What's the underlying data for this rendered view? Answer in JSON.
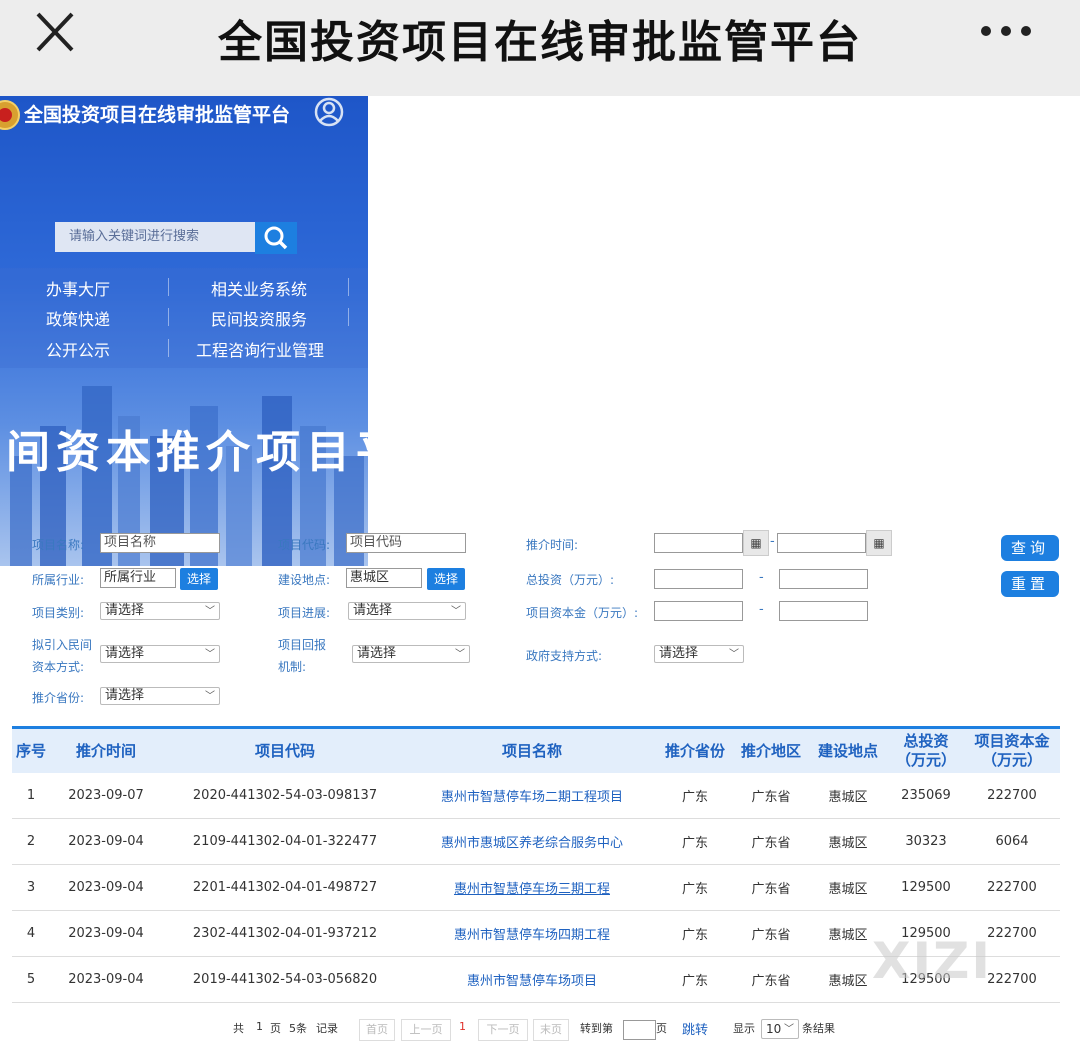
{
  "topbar": {
    "title": "全国投资项目在线审批监管平台"
  },
  "site": {
    "title": "全国投资项目在线审批监管平台"
  },
  "search": {
    "placeholder": "请输入关键词进行搜索"
  },
  "nav": {
    "items": [
      "办事大厅",
      "相关业务系统",
      "政策快递",
      "民间投资服务",
      "公开公示",
      "工程咨询行业管理"
    ]
  },
  "banner": {
    "text": "间资本推介项目平"
  },
  "form": {
    "project_name_label": "项目名称:",
    "project_name_placeholder": "项目名称",
    "project_code_label": "项目代码:",
    "project_code_placeholder": "项目代码",
    "promo_time_label": "推介时间:",
    "date_dash": "-",
    "industry_label": "所属行业:",
    "industry_placeholder": "所属行业",
    "select_label": "选择",
    "location_label": "建设地点:",
    "location_value": "惠城区",
    "total_invest_label": "总投资（万元）:",
    "range_dash": "-",
    "category_label": "项目类别:",
    "please_select": "请选择",
    "progress_label": "项目进展:",
    "capital_label": "项目资本金（万元）:",
    "private_capital_label_1": "拟引入民间",
    "private_capital_label_2": "资本方式:",
    "return_label_1": "项目回报",
    "return_label_2": "机制:",
    "gov_support_label": "政府支持方式:",
    "province_label": "推介省份:",
    "query_button": "查询",
    "reset_button": "重置"
  },
  "table": {
    "headers": [
      "序号",
      "推介时间",
      "项目代码",
      "项目名称",
      "推介省份",
      "推介地区",
      "建设地点",
      "总投资\n（万元）",
      "项目资本金\n（万元）"
    ],
    "rows": [
      [
        "1",
        "2023-09-07",
        "2020-441302-54-03-098137",
        "惠州市智慧停车场二期工程项目",
        "广东",
        "广东省",
        "惠城区",
        "235069",
        "222700"
      ],
      [
        "2",
        "2023-09-04",
        "2109-441302-04-01-322477",
        "惠州市惠城区养老综合服务中心",
        "广东",
        "广东省",
        "惠城区",
        "30323",
        "6064"
      ],
      [
        "3",
        "2023-09-04",
        "2201-441302-04-01-498727",
        "惠州市智慧停车场三期工程",
        "广东",
        "广东省",
        "惠城区",
        "129500",
        "222700"
      ],
      [
        "4",
        "2023-09-04",
        "2302-441302-04-01-937212",
        "惠州市智慧停车场四期工程",
        "广东",
        "广东省",
        "惠城区",
        "129500",
        "222700"
      ],
      [
        "5",
        "2023-09-04",
        "2019-441302-54-03-056820",
        "惠州市智慧停车场项目",
        "广东",
        "广东省",
        "惠城区",
        "129500",
        "222700"
      ]
    ]
  },
  "pager": {
    "total_prefix": "共",
    "pages": "1",
    "pages_unit": "页",
    "records": "5条",
    "records_unit": "记录",
    "first": "首页",
    "prev": "上一页",
    "current": "1",
    "next": "下一页",
    "last": "末页",
    "goto_prefix": "转到第",
    "goto_suffix": "页",
    "jump": "跳转",
    "show_prefix": "显示",
    "page_size": "10",
    "show_suffix": "条结果"
  },
  "watermark": "XIZI",
  "colors": {
    "accent": "#1d7fe0",
    "label": "#3a78c0",
    "header_bg": "#e3eefb",
    "link": "#1f62c0"
  }
}
